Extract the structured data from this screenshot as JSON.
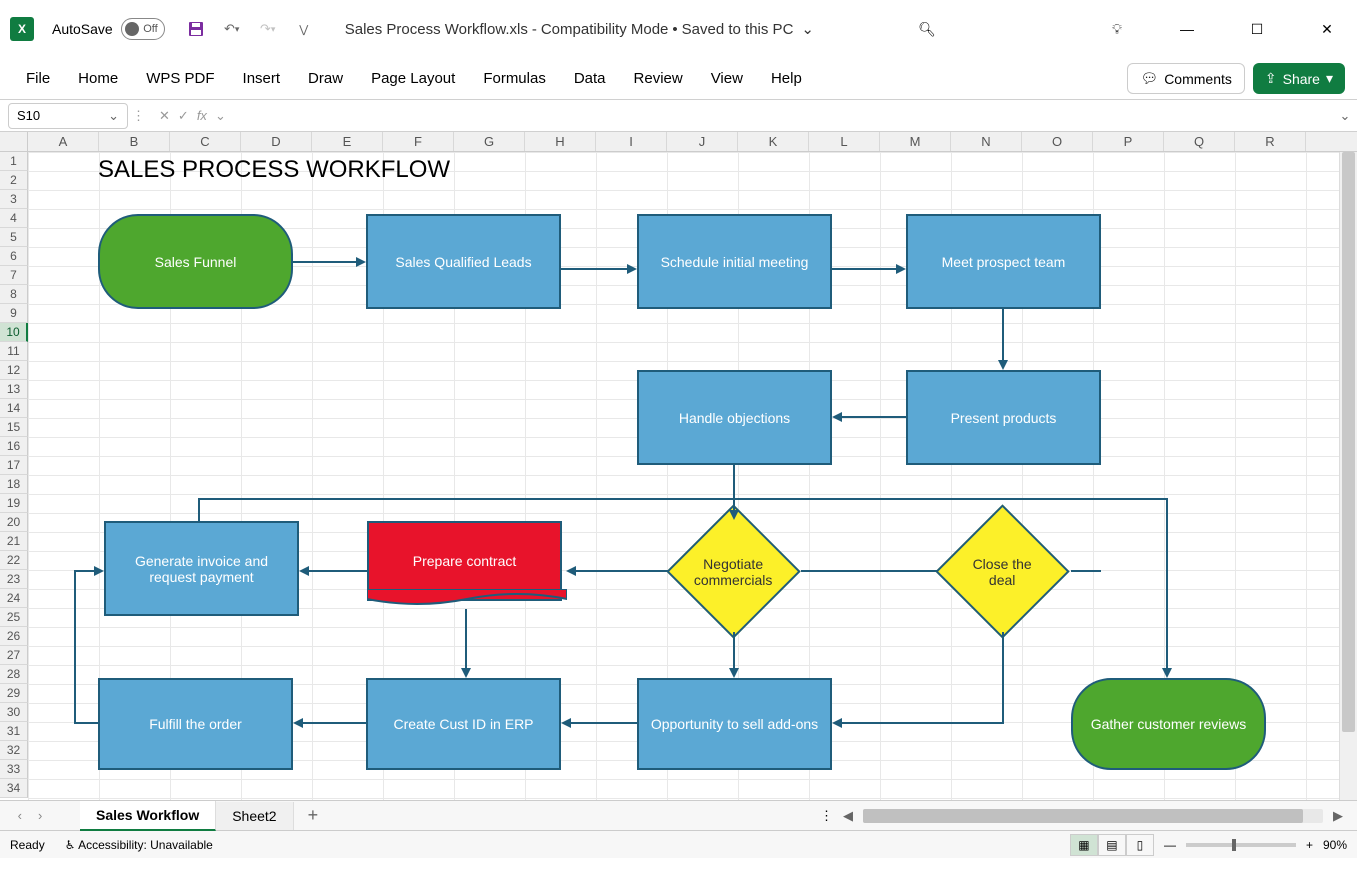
{
  "titlebar": {
    "autosave_label": "AutoSave",
    "autosave_state": "Off",
    "doc_name": "Sales Process Workflow.xls",
    "doc_mode": "Compatibility Mode",
    "doc_saved": "Saved to this PC"
  },
  "ribbon": {
    "tabs": [
      "File",
      "Home",
      "WPS PDF",
      "Insert",
      "Draw",
      "Page Layout",
      "Formulas",
      "Data",
      "Review",
      "View",
      "Help"
    ],
    "comments": "Comments",
    "share": "Share"
  },
  "formula": {
    "name_box": "S10",
    "fx": "fx",
    "value": ""
  },
  "columns": [
    "A",
    "B",
    "C",
    "D",
    "E",
    "F",
    "G",
    "H",
    "I",
    "J",
    "K",
    "L",
    "M",
    "N",
    "O",
    "P",
    "Q",
    "R"
  ],
  "rows": [
    "1",
    "2",
    "3",
    "4",
    "5",
    "6",
    "7",
    "8",
    "9",
    "10",
    "11",
    "12",
    "13",
    "14",
    "15",
    "16",
    "17",
    "18",
    "19",
    "20",
    "21",
    "22",
    "23",
    "24",
    "25",
    "26",
    "27",
    "28",
    "29",
    "30",
    "31",
    "32",
    "33",
    "34"
  ],
  "diagram": {
    "title": "SALES PROCESS WORKFLOW",
    "shapes": {
      "start": "Sales Funnel",
      "sql": "Sales Qualified Leads",
      "schedule": "Schedule initial meeting",
      "meet": "Meet prospect team",
      "present": "Present products",
      "handle": "Handle objections",
      "negotiate": "Negotiate commercials",
      "close": "Close the deal",
      "prepare": "Prepare contract",
      "invoice": "Generate invoice and request payment",
      "create_id": "Create Cust ID in ERP",
      "opportunity": "Opportunity to sell add-ons",
      "fulfill": "Fulfill the order",
      "gather": "Gather customer reviews"
    }
  },
  "sheets": {
    "tabs": [
      "Sales Workflow",
      "Sheet2"
    ],
    "active": 0
  },
  "status": {
    "ready": "Ready",
    "accessibility": "Accessibility: Unavailable",
    "zoom": "90%"
  },
  "chart_data": {
    "type": "flowchart",
    "title": "SALES PROCESS WORKFLOW",
    "nodes": [
      {
        "id": "start",
        "type": "terminator",
        "label": "Sales Funnel"
      },
      {
        "id": "sql",
        "type": "process",
        "label": "Sales Qualified Leads"
      },
      {
        "id": "schedule",
        "type": "process",
        "label": "Schedule initial meeting"
      },
      {
        "id": "meet",
        "type": "process",
        "label": "Meet prospect team"
      },
      {
        "id": "present",
        "type": "process",
        "label": "Present products"
      },
      {
        "id": "handle",
        "type": "process",
        "label": "Handle objections"
      },
      {
        "id": "negotiate",
        "type": "decision",
        "label": "Negotiate commercials"
      },
      {
        "id": "close",
        "type": "decision",
        "label": "Close the deal"
      },
      {
        "id": "prepare",
        "type": "document",
        "label": "Prepare contract"
      },
      {
        "id": "invoice",
        "type": "process",
        "label": "Generate invoice and request payment"
      },
      {
        "id": "create_id",
        "type": "process",
        "label": "Create Cust ID in ERP"
      },
      {
        "id": "opportunity",
        "type": "process",
        "label": "Opportunity to sell add-ons"
      },
      {
        "id": "fulfill",
        "type": "process",
        "label": "Fulfill the order"
      },
      {
        "id": "gather",
        "type": "terminator",
        "label": "Gather customer reviews"
      }
    ],
    "edges": [
      [
        "start",
        "sql"
      ],
      [
        "sql",
        "schedule"
      ],
      [
        "schedule",
        "meet"
      ],
      [
        "meet",
        "present"
      ],
      [
        "present",
        "handle"
      ],
      [
        "handle",
        "negotiate"
      ],
      [
        "handle",
        "close"
      ],
      [
        "negotiate",
        "prepare"
      ],
      [
        "negotiate",
        "opportunity"
      ],
      [
        "close",
        "opportunity"
      ],
      [
        "close",
        "gather"
      ],
      [
        "prepare",
        "invoice"
      ],
      [
        "prepare",
        "create_id"
      ],
      [
        "create_id",
        "fulfill"
      ],
      [
        "opportunity",
        "create_id"
      ],
      [
        "fulfill",
        "invoice"
      ]
    ]
  }
}
